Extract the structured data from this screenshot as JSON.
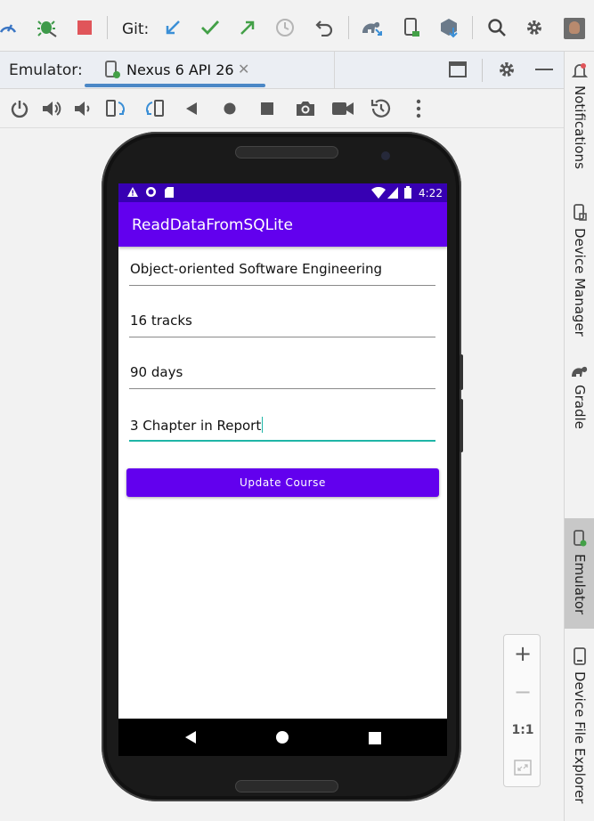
{
  "toolbar": {
    "git_label": "Git:"
  },
  "emulator_bar": {
    "label": "Emulator:",
    "tab_label": "Nexus 6 API 26",
    "close_glyph": "✕"
  },
  "device": {
    "status_time": "4:22",
    "app_title": "ReadDataFromSQLite",
    "fields": [
      {
        "value": "Object-oriented Software Engineering"
      },
      {
        "value": "16 tracks"
      },
      {
        "value": "90 days"
      },
      {
        "value": "3 Chapter in Report"
      }
    ],
    "update_button": "Update Course"
  },
  "right_tools": [
    {
      "label": "Notifications"
    },
    {
      "label": "Device Manager"
    },
    {
      "label": "Gradle"
    },
    {
      "label": "Emulator"
    },
    {
      "label": "Device File Explorer"
    }
  ],
  "zoom": {
    "plus": "+",
    "minus": "−",
    "actual": "1:1"
  },
  "colors": {
    "app_primary": "#6200ee",
    "status_bar": "#3700b3",
    "focus_accent": "#1fb5a7",
    "tab_underline": "#4b87c6"
  }
}
